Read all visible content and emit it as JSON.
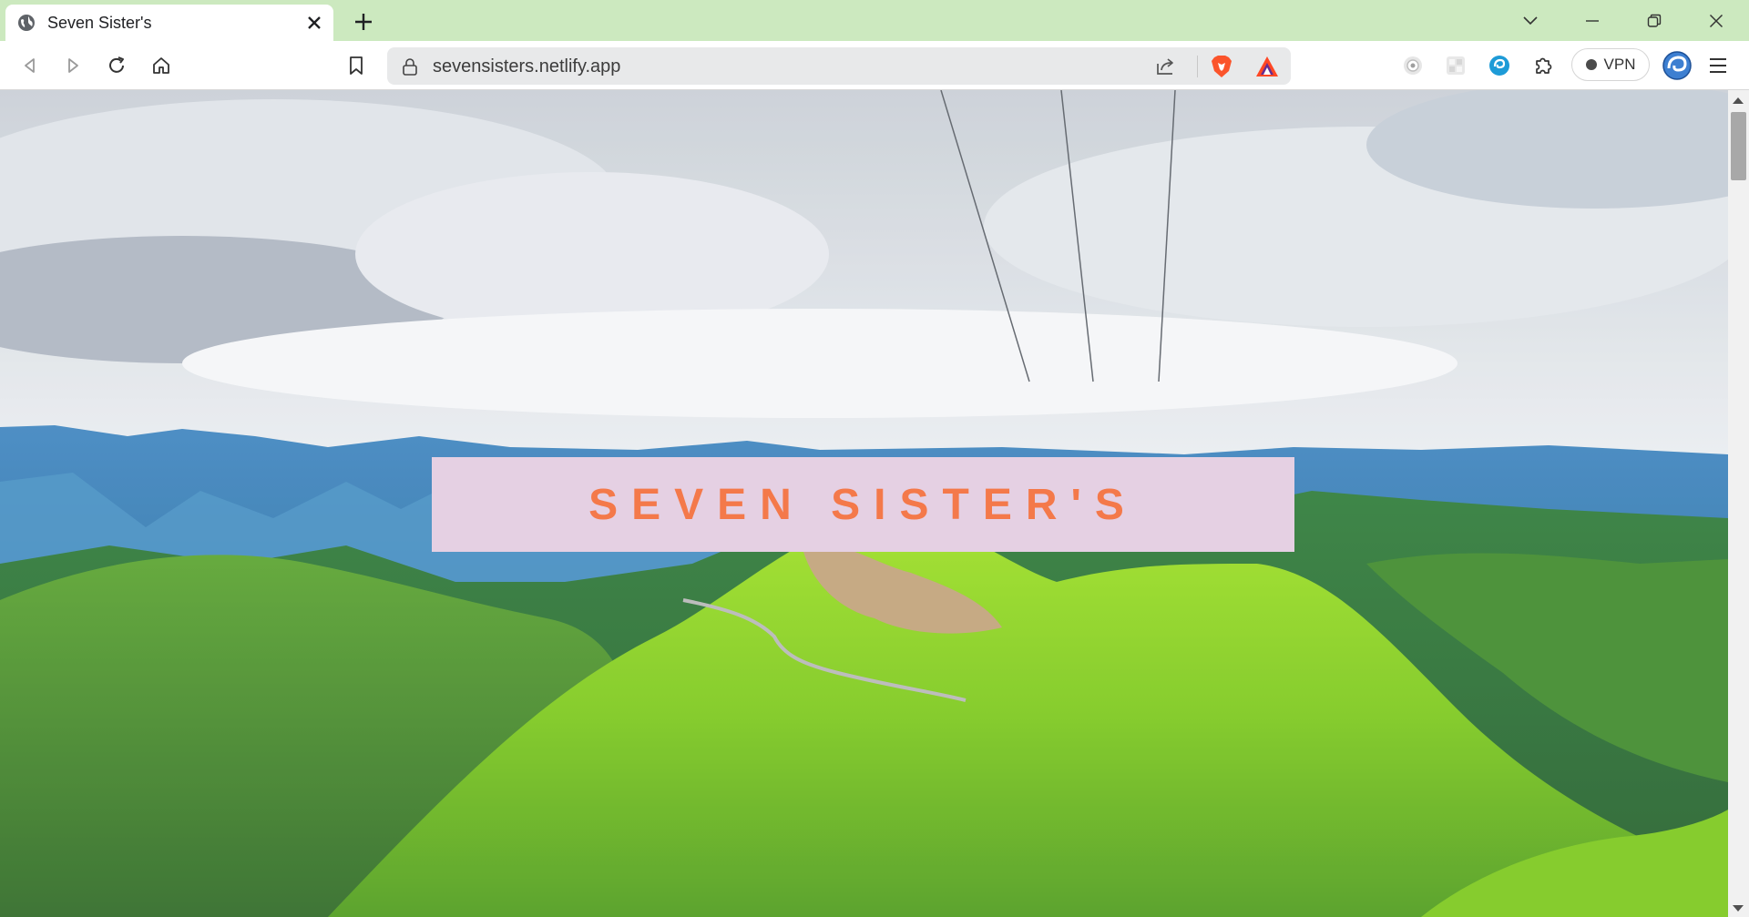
{
  "browser": {
    "tab_title": "Seven Sister's",
    "url": "sevensisters.netlify.app",
    "vpn_label": "VPN",
    "accent_color": "#cce9bf"
  },
  "icons": {
    "tab_favicon": "globe-icon",
    "tab_close": "close-icon",
    "new_tab": "plus-icon",
    "tab_search": "chevron-down-icon",
    "minimize": "minimize-icon",
    "restore": "restore-icon",
    "window_close": "close-icon",
    "back": "back-arrow-icon",
    "forward": "forward-arrow-icon",
    "reload": "reload-icon",
    "home": "home-icon",
    "bookmark": "bookmark-icon",
    "lock": "lock-icon",
    "share": "share-icon",
    "brave_shields": "brave-lion-icon",
    "brave_rewards": "bat-triangle-icon",
    "extensions": [
      "camera-extension-icon",
      "grid-extension-icon",
      "swirl-extension-icon",
      "puzzle-icon"
    ],
    "wallet": "wallet-icon",
    "menu": "hamburger-menu-icon"
  },
  "page": {
    "banner_text": "SEVEN SISTER'S",
    "banner_bg": "#e5d0e3",
    "banner_text_color": "#f4794a",
    "hero_image": "green-hills-landscape"
  }
}
